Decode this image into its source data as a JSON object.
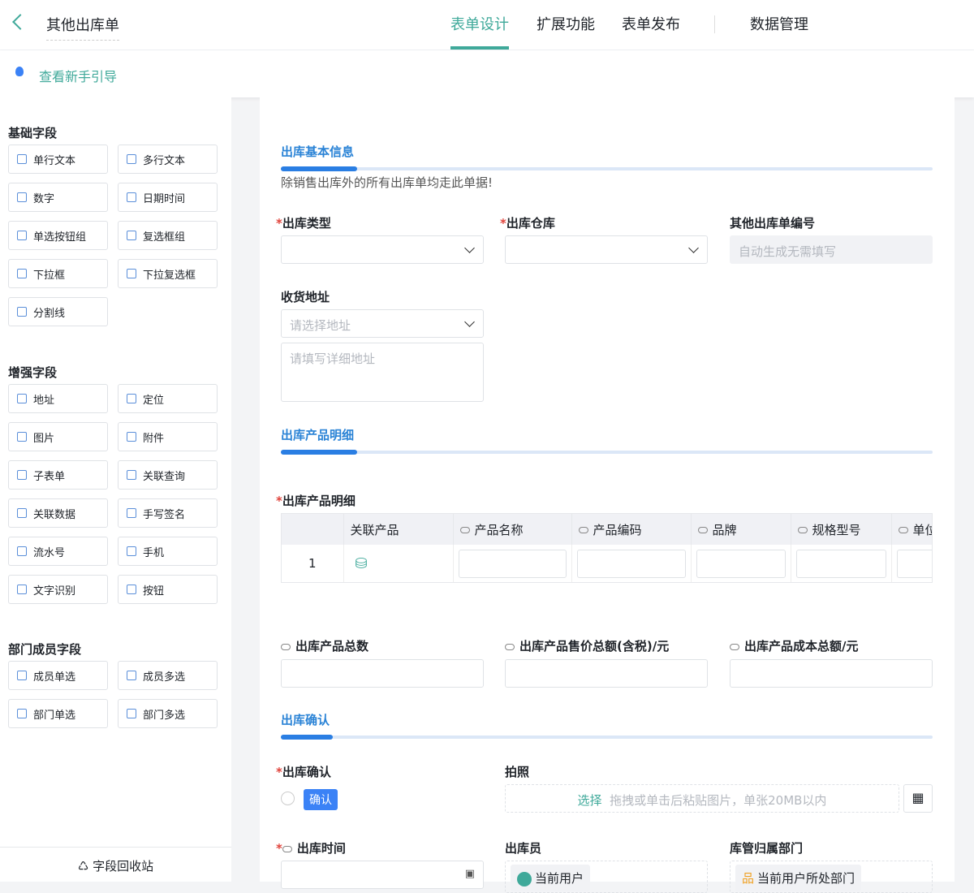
{
  "header": {
    "title": "其他出库单",
    "tabs": [
      "表单设计",
      "扩展功能",
      "表单发布",
      "数据管理"
    ],
    "active_tab": 0
  },
  "guide": {
    "label": "查看新手引导"
  },
  "sidebar": {
    "sections": [
      {
        "title": "基础字段",
        "items": [
          "单行文本",
          "多行文本",
          "数字",
          "日期时间",
          "单选按钮组",
          "复选框组",
          "下拉框",
          "下拉复选框",
          "分割线"
        ]
      },
      {
        "title": "增强字段",
        "items": [
          "地址",
          "定位",
          "图片",
          "附件",
          "子表单",
          "关联查询",
          "关联数据",
          "手写签名",
          "流水号",
          "手机",
          "文字识别",
          "按钮"
        ]
      },
      {
        "title": "部门成员字段",
        "items": [
          "成员单选",
          "成员多选",
          "部门单选",
          "部门多选"
        ]
      }
    ],
    "recycle": "字段回收站"
  },
  "form": {
    "sec1": {
      "title": "出库基本信息",
      "desc": "除销售出库外的所有出库单均走此单据!"
    },
    "type_label": "出库类型",
    "warehouse_label": "出库仓库",
    "number_label": "其他出库单编号",
    "number_placeholder": "自动生成无需填写",
    "address_label": "收货地址",
    "address_placeholder": "请选择地址",
    "address_detail_placeholder": "请填写详细地址",
    "sec2": {
      "title": "出库产品明细"
    },
    "detail_label": "出库产品明细",
    "table": {
      "headers": [
        "关联产品",
        "产品名称",
        "产品编码",
        "品牌",
        "规格型号",
        "单位"
      ],
      "row_index": "1"
    },
    "total_qty": "出库产品总数",
    "total_price": "出库产品售价总额(含税)/元",
    "total_cost": "出库产品成本总额/元",
    "sec3": {
      "title": "出库确认"
    },
    "confirm_label": "出库确认",
    "confirm_option": "确认",
    "photo_label": "拍照",
    "photo_select": "选择",
    "photo_hint": "拖拽或单击后粘贴图片，单张20MB以内",
    "time_label": "出库时间",
    "clerk_label": "出库员",
    "clerk_value": "当前用户",
    "dept_label": "库管归属部门",
    "dept_value": "当前用户所处部门"
  }
}
